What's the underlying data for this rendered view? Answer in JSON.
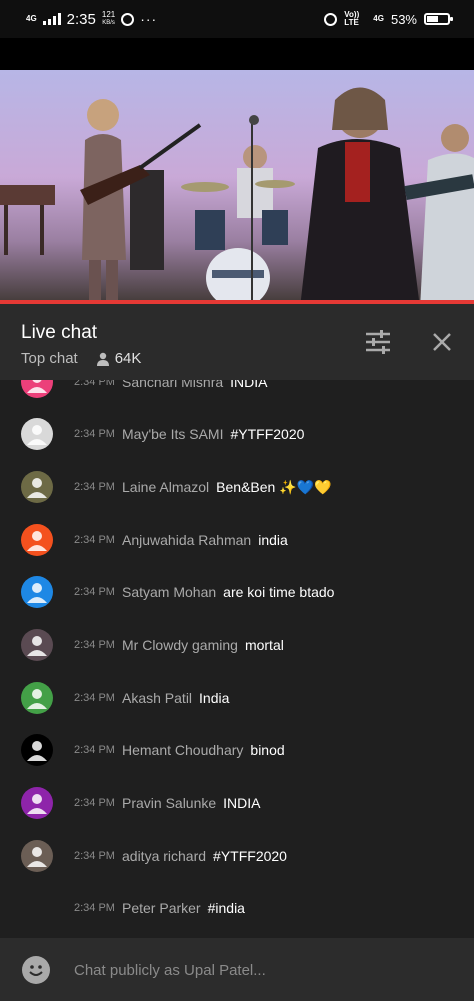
{
  "status_bar": {
    "network": "4G",
    "time": "2:35",
    "speed": "121",
    "speed_unit": "KB/s",
    "dots": "···",
    "volte": "Vo)) LTE",
    "network2": "4G",
    "battery": "53%",
    "battery_level": 0.53
  },
  "chat": {
    "title": "Live chat",
    "mode": "Top chat",
    "viewers": "64K",
    "input_placeholder": "Chat publicly as Upal Patel..."
  },
  "messages": [
    {
      "time": "2:34 PM",
      "author": "Sanchari Mishra",
      "text": "INDIA",
      "avatar_color": "#ec407a"
    },
    {
      "time": "2:34 PM",
      "author": "May'be Its SAMI",
      "text": "#YTFF2020",
      "avatar_color": "#d9d9d9"
    },
    {
      "time": "2:34 PM",
      "author": "Laine Almazol",
      "text": "Ben&Ben ✨💙💛",
      "avatar_color": "#6d6a45"
    },
    {
      "time": "2:34 PM",
      "author": "Anjuwahida Rahman",
      "text": "india",
      "avatar_color": "#f4511e"
    },
    {
      "time": "2:34 PM",
      "author": "Satyam Mohan",
      "text": "are koi time btado",
      "avatar_color": "#1e88e5"
    },
    {
      "time": "2:34 PM",
      "author": "Mr Clowdy gaming",
      "text": "mortal",
      "avatar_color": "#5a4a52"
    },
    {
      "time": "2:34 PM",
      "author": "Akash Patil",
      "text": "India",
      "avatar_color": "#43a047"
    },
    {
      "time": "2:34 PM",
      "author": "Hemant Choudhary",
      "text": "binod",
      "avatar_color": "#000000"
    },
    {
      "time": "2:34 PM",
      "author": "Pravin Salunke",
      "text": "INDIA",
      "avatar_color": "#8e24aa"
    },
    {
      "time": "2:34 PM",
      "author": "aditya richard",
      "text": "#YTFF2020",
      "avatar_color": "#6b5e55"
    },
    {
      "time": "2:34 PM",
      "author": "Peter Parker",
      "text": "#india",
      "avatar_color": "#1f1f1f"
    }
  ]
}
